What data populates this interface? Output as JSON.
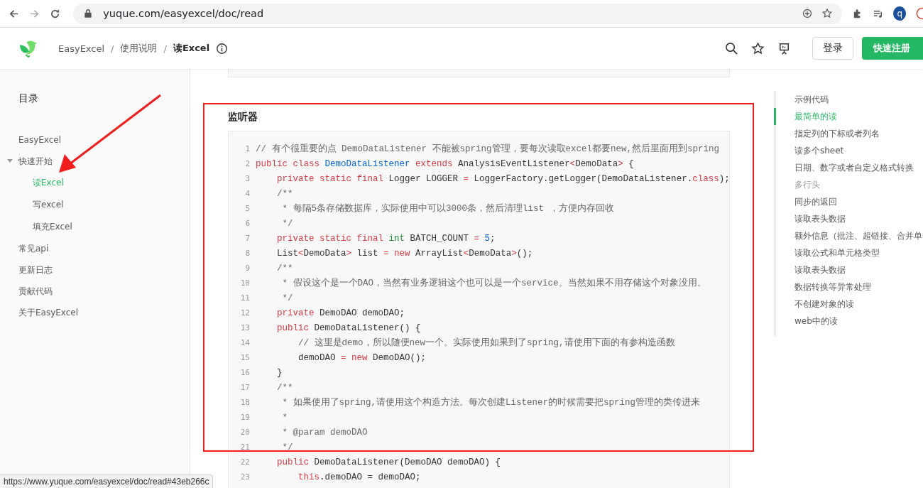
{
  "browser": {
    "url": "yuque.com/easyexcel/doc/read",
    "avatar": "q"
  },
  "header": {
    "breadcrumb": [
      {
        "kind": "link",
        "text": "EasyExcel"
      },
      {
        "kind": "separator",
        "text": "/"
      },
      {
        "kind": "link",
        "text": "使用说明"
      },
      {
        "kind": "separator",
        "text": "/"
      },
      {
        "kind": "current",
        "text": "读Excel"
      }
    ],
    "login": "登录",
    "signup": "快速注册"
  },
  "sidebar": {
    "title": "目录",
    "items": [
      {
        "label": "EasyExcel",
        "selected": false
      },
      {
        "label": "快速开始",
        "selected": false,
        "expanded": true,
        "children": [
          {
            "label": "读Excel",
            "selected": true
          },
          {
            "label": "写excel",
            "selected": false
          },
          {
            "label": "填充Excel",
            "selected": false
          }
        ]
      },
      {
        "label": "常见api",
        "selected": false
      },
      {
        "label": "更新日志",
        "selected": false
      },
      {
        "label": "贡献代码",
        "selected": false
      },
      {
        "label": "关于EasyExcel",
        "selected": false
      }
    ]
  },
  "section": {
    "heading": "监听器",
    "code": [
      {
        "n": "1",
        "tokens": [
          {
            "kind": "comment",
            "text": "// 有个很重要的点 DemoDataListener 不能被spring管理，要每次读取excel都要new,然后里面用到spring"
          }
        ]
      },
      {
        "n": "2",
        "tokens": [
          {
            "kind": "keyword",
            "text": "public class "
          },
          {
            "kind": "type",
            "text": "DemoDataListener "
          },
          {
            "kind": "keyword",
            "text": "extends "
          },
          {
            "kind": "plain",
            "text": "AnalysisEventListener"
          },
          {
            "kind": "operator",
            "text": "<"
          },
          {
            "kind": "plain",
            "text": "DemoData"
          },
          {
            "kind": "operator",
            "text": ">"
          },
          {
            "kind": "plain",
            "text": " {"
          }
        ]
      },
      {
        "n": "3",
        "tokens": [
          {
            "kind": "keyword",
            "text": "    private static final "
          },
          {
            "kind": "plain",
            "text": "Logger LOGGER "
          },
          {
            "kind": "operator",
            "text": "="
          },
          {
            "kind": "plain",
            "text": " LoggerFactory.getLogger(DemoDataListener."
          },
          {
            "kind": "keyword",
            "text": "class"
          },
          {
            "kind": "plain",
            "text": ");"
          }
        ]
      },
      {
        "n": "4",
        "tokens": [
          {
            "kind": "comment",
            "text": "    /**"
          }
        ]
      },
      {
        "n": "5",
        "tokens": [
          {
            "kind": "comment",
            "text": "     * 每隔5条存储数据库，实际使用中可以3000条，然后清理list ，方便内存回收"
          }
        ]
      },
      {
        "n": "6",
        "tokens": [
          {
            "kind": "comment",
            "text": "     */"
          }
        ]
      },
      {
        "n": "7",
        "tokens": [
          {
            "kind": "keyword",
            "text": "    private static final "
          },
          {
            "kind": "builtin",
            "text": "int"
          },
          {
            "kind": "plain",
            "text": " BATCH_COUNT "
          },
          {
            "kind": "operator",
            "text": "="
          },
          {
            "kind": "number",
            "text": " 5"
          },
          {
            "kind": "plain",
            "text": ";"
          }
        ]
      },
      {
        "n": "8",
        "tokens": [
          {
            "kind": "plain",
            "text": "    List"
          },
          {
            "kind": "operator",
            "text": "<"
          },
          {
            "kind": "plain",
            "text": "DemoData"
          },
          {
            "kind": "operator",
            "text": ">"
          },
          {
            "kind": "plain",
            "text": " list "
          },
          {
            "kind": "operator",
            "text": "="
          },
          {
            "kind": "keyword",
            "text": " new"
          },
          {
            "kind": "plain",
            "text": " ArrayList"
          },
          {
            "kind": "operator",
            "text": "<"
          },
          {
            "kind": "plain",
            "text": "DemoData"
          },
          {
            "kind": "operator",
            "text": ">"
          },
          {
            "kind": "plain",
            "text": "();"
          }
        ]
      },
      {
        "n": "9",
        "tokens": [
          {
            "kind": "comment",
            "text": "    /**"
          }
        ]
      },
      {
        "n": "10",
        "tokens": [
          {
            "kind": "comment",
            "text": "     * 假设这个是一个DAO，当然有业务逻辑这个也可以是一个service。当然如果不用存储这个对象没用。"
          }
        ]
      },
      {
        "n": "11",
        "tokens": [
          {
            "kind": "comment",
            "text": "     */"
          }
        ]
      },
      {
        "n": "12",
        "tokens": [
          {
            "kind": "keyword",
            "text": "    private"
          },
          {
            "kind": "plain",
            "text": " DemoDAO demoDAO;"
          }
        ]
      },
      {
        "n": "13",
        "tokens": [
          {
            "kind": "keyword",
            "text": "    public"
          },
          {
            "kind": "plain",
            "text": " DemoDataListener() {"
          }
        ]
      },
      {
        "n": "14",
        "tokens": [
          {
            "kind": "comment",
            "text": "        // 这里是demo，所以随便new一个。实际使用如果到了spring,请使用下面的有参构造函数"
          }
        ]
      },
      {
        "n": "15",
        "tokens": [
          {
            "kind": "plain",
            "text": "        demoDAO "
          },
          {
            "kind": "operator",
            "text": "="
          },
          {
            "kind": "keyword",
            "text": " new"
          },
          {
            "kind": "plain",
            "text": " DemoDAO();"
          }
        ]
      },
      {
        "n": "16",
        "tokens": [
          {
            "kind": "plain",
            "text": "    }"
          }
        ]
      },
      {
        "n": "17",
        "tokens": [
          {
            "kind": "comment",
            "text": "    /**"
          }
        ]
      },
      {
        "n": "18",
        "tokens": [
          {
            "kind": "comment",
            "text": "     * 如果使用了spring,请使用这个构造方法。每次创建Listener的时候需要把spring管理的类传进来"
          }
        ]
      },
      {
        "n": "19",
        "tokens": [
          {
            "kind": "comment",
            "text": "     *"
          }
        ]
      },
      {
        "n": "20",
        "tokens": [
          {
            "kind": "comment",
            "text": "     * @param demoDAO"
          }
        ]
      },
      {
        "n": "21",
        "tokens": [
          {
            "kind": "comment",
            "text": "     */"
          }
        ]
      },
      {
        "n": "22",
        "tokens": [
          {
            "kind": "keyword",
            "text": "    public"
          },
          {
            "kind": "plain",
            "text": " DemoDataListener(DemoDAO demoDAO) {"
          }
        ]
      },
      {
        "n": "23",
        "tokens": [
          {
            "kind": "keyword",
            "text": "        this"
          },
          {
            "kind": "plain",
            "text": ".demoDAO = demoDAO;"
          }
        ]
      }
    ]
  },
  "toc": [
    {
      "label": "示例代码",
      "selected": false,
      "muted": false
    },
    {
      "label": "最简单的读",
      "selected": true,
      "muted": false
    },
    {
      "label": "指定列的下标或者列名",
      "selected": false,
      "muted": false
    },
    {
      "label": "读多个sheet",
      "selected": false,
      "muted": false
    },
    {
      "label": "日期、数字或者自定义格式转换",
      "selected": false,
      "muted": false
    },
    {
      "label": "多行头",
      "selected": false,
      "muted": true
    },
    {
      "label": "同步的返回",
      "selected": false,
      "muted": false
    },
    {
      "label": "读取表头数据",
      "selected": false,
      "muted": false
    },
    {
      "label": "额外信息（批注、超链接、合并单",
      "selected": false,
      "muted": false
    },
    {
      "label": "读取公式和单元格类型",
      "selected": false,
      "muted": false
    },
    {
      "label": "读取表头数据",
      "selected": false,
      "muted": false
    },
    {
      "label": "数据转换等异常处理",
      "selected": false,
      "muted": false
    },
    {
      "label": "不创建对象的读",
      "selected": false,
      "muted": false
    },
    {
      "label": "web中的读",
      "selected": false,
      "muted": false
    }
  ],
  "status_bar": "https://www.yuque.com/easyexcel/doc/read#43eb266c"
}
